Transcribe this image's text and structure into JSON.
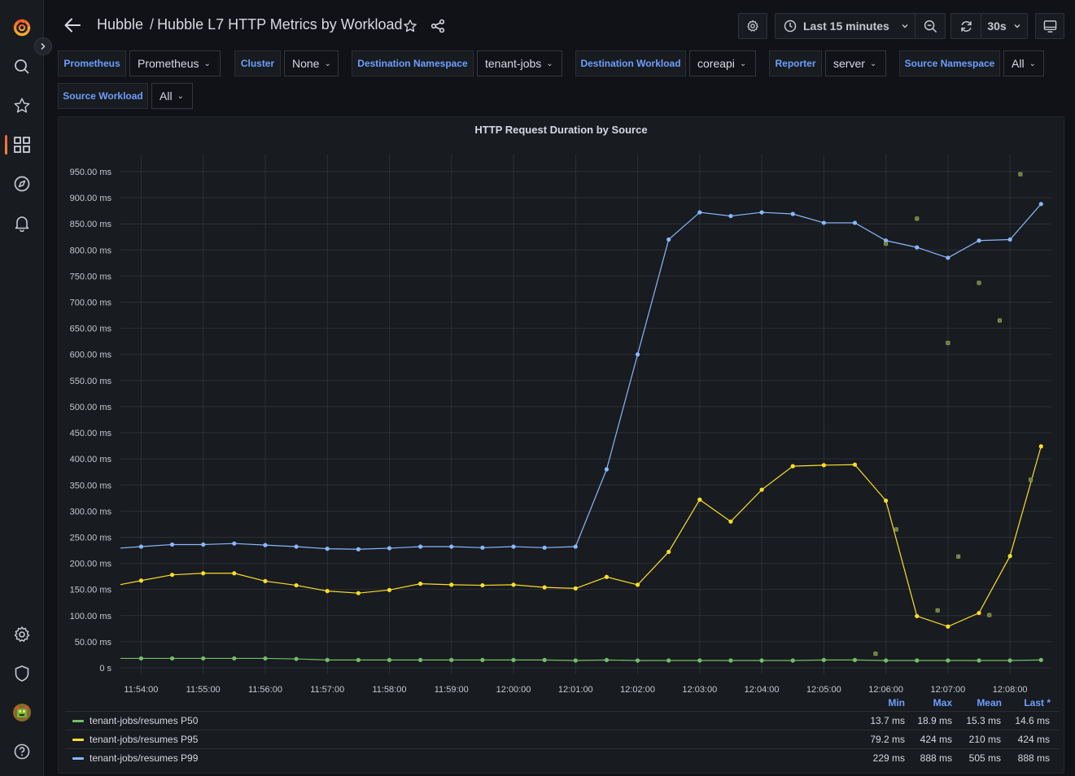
{
  "header": {
    "folder": "Hubble",
    "title": "Hubble L7 HTTP Metrics by Workload",
    "time_range": "Last 15 minutes",
    "refresh_interval": "30s"
  },
  "variables": [
    {
      "label": "Prometheus",
      "value": "Prometheus"
    },
    {
      "label": "Cluster",
      "value": "None"
    },
    {
      "label": "Destination Namespace",
      "value": "tenant-jobs"
    },
    {
      "label": "Destination Workload",
      "value": "coreapi"
    },
    {
      "label": "Reporter",
      "value": "server"
    },
    {
      "label": "Source Namespace",
      "value": "All"
    },
    {
      "label": "Source Workload",
      "value": "All"
    }
  ],
  "panel": {
    "title": "HTTP Request Duration by Source"
  },
  "legend": {
    "columns": [
      "Min",
      "Max",
      "Mean",
      "Last *"
    ],
    "rows": [
      {
        "name": "tenant-jobs/resumes P50",
        "color": "#73bf69",
        "min": "13.7 ms",
        "max": "18.9 ms",
        "mean": "15.3 ms",
        "last": "14.6 ms"
      },
      {
        "name": "tenant-jobs/resumes P95",
        "color": "#fade2a",
        "min": "79.2 ms",
        "max": "424 ms",
        "mean": "210 ms",
        "last": "424 ms"
      },
      {
        "name": "tenant-jobs/resumes P99",
        "color": "#8ab8ff",
        "min": "229 ms",
        "max": "888 ms",
        "mean": "505 ms",
        "last": "888 ms"
      }
    ]
  },
  "chart_data": {
    "type": "line",
    "title": "HTTP Request Duration by Source",
    "y_unit": "ms",
    "ylim": [
      0,
      950
    ],
    "y_ticks": [
      "0 s",
      "50.00 ms",
      "100.00 ms",
      "150.00 ms",
      "200.00 ms",
      "250.00 ms",
      "300.00 ms",
      "350.00 ms",
      "400.00 ms",
      "450.00 ms",
      "500.00 ms",
      "550.00 ms",
      "600.00 ms",
      "650.00 ms",
      "700.00 ms",
      "750.00 ms",
      "800.00 ms",
      "850.00 ms",
      "900.00 ms",
      "950.00 ms"
    ],
    "x_ticks": [
      "11:54:00",
      "11:55:00",
      "11:56:00",
      "11:57:00",
      "11:58:00",
      "11:59:00",
      "12:00:00",
      "12:01:00",
      "12:02:00",
      "12:03:00",
      "12:04:00",
      "12:05:00",
      "12:06:00",
      "12:07:00",
      "12:08:00"
    ],
    "xlim": [
      "11:53:40",
      "12:08:40"
    ],
    "x": [
      "11:54:00",
      "11:54:30",
      "11:55:00",
      "11:55:30",
      "11:56:00",
      "11:56:30",
      "11:57:00",
      "11:57:30",
      "11:58:00",
      "11:58:30",
      "11:59:00",
      "11:59:30",
      "12:00:00",
      "12:00:30",
      "12:01:00",
      "12:01:30",
      "12:02:00",
      "12:02:30",
      "12:03:00",
      "12:03:30",
      "12:04:00",
      "12:04:30",
      "12:05:00",
      "12:05:30",
      "12:06:00",
      "12:06:30",
      "12:07:00",
      "12:07:30",
      "12:08:00",
      "12:08:30"
    ],
    "grid": true,
    "legend_position": "bottom",
    "series": [
      {
        "name": "tenant-jobs/resumes P50",
        "color": "#73bf69",
        "values": [
          18,
          18,
          18,
          18,
          18,
          17,
          15,
          15,
          15,
          15,
          15,
          15,
          15,
          15,
          14,
          15,
          14,
          14,
          14,
          14,
          14,
          14,
          15,
          15,
          14,
          14,
          14,
          14,
          14,
          15
        ]
      },
      {
        "name": "tenant-jobs/resumes P95",
        "color": "#fade2a",
        "values": [
          167,
          178,
          181,
          181,
          166,
          158,
          147,
          143,
          149,
          161,
          159,
          158,
          159,
          154,
          152,
          174,
          159,
          222,
          322,
          280,
          341,
          386,
          388,
          389,
          320,
          99,
          79,
          105,
          214,
          424
        ]
      },
      {
        "name": "tenant-jobs/resumes P99",
        "color": "#8ab8ff",
        "values": [
          232,
          236,
          236,
          238,
          235,
          232,
          228,
          227,
          229,
          232,
          232,
          230,
          232,
          230,
          232,
          380,
          600,
          820,
          872,
          865,
          872,
          869,
          852,
          852,
          818,
          805,
          785,
          818,
          820,
          888
        ]
      }
    ],
    "markers": {
      "color": "#a8b96a",
      "points": [
        [
          "12:05:50",
          27
        ],
        [
          "12:06:00",
          812
        ],
        [
          "12:06:10",
          265
        ],
        [
          "12:06:30",
          860
        ],
        [
          "12:06:50",
          110
        ],
        [
          "12:07:00",
          622
        ],
        [
          "12:07:10",
          213
        ],
        [
          "12:07:30",
          737
        ],
        [
          "12:07:40",
          101
        ],
        [
          "12:07:50",
          665
        ],
        [
          "12:08:10",
          945
        ],
        [
          "12:08:20",
          360
        ]
      ]
    }
  }
}
